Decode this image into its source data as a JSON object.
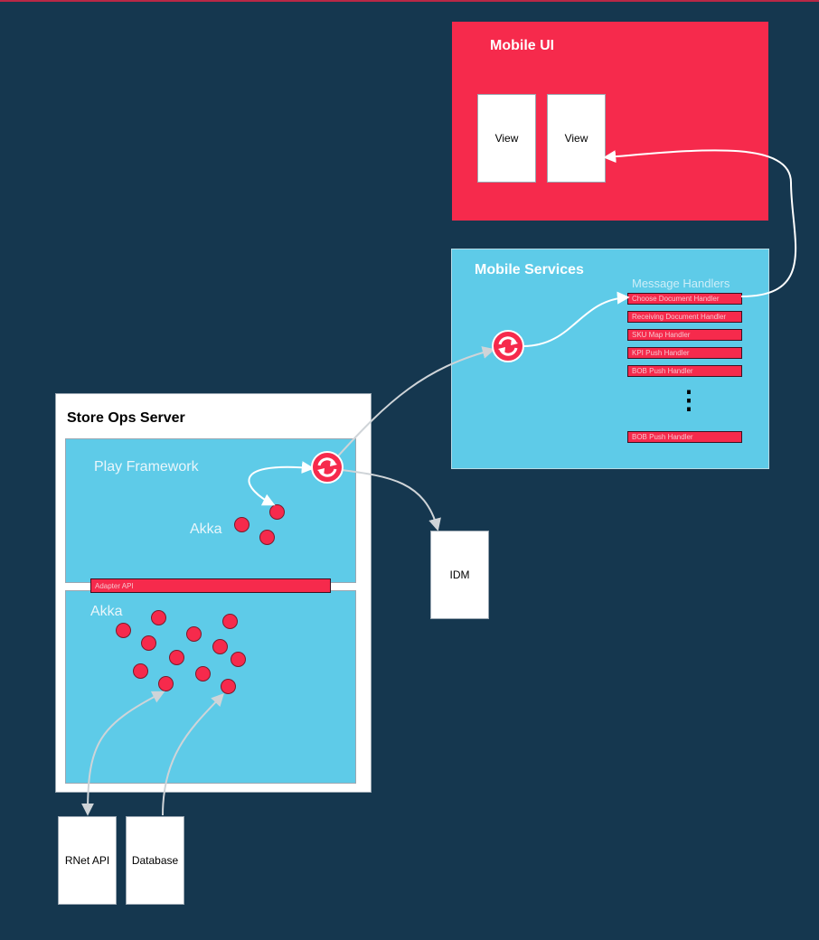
{
  "mobile_ui": {
    "title": "Mobile UI",
    "views": [
      "View",
      "View"
    ]
  },
  "mobile_services": {
    "title": "Mobile Services",
    "handlers_heading": "Message Handlers",
    "handlers": [
      "Choose Document Handler",
      "Receiving Document Handler",
      "SKU Map Handler",
      "KPI Push Handler",
      "BOB Push Handler"
    ],
    "ellipsis": "⋮",
    "last_handler": "BOB Push Handler"
  },
  "store_ops": {
    "title": "Store Ops Server",
    "play_label": "Play Framework",
    "play_akka_label": "Akka",
    "adapter_label": "Adapter API",
    "akka_label": "Akka"
  },
  "externals": {
    "idm": "IDM",
    "rnet": "RNet API",
    "database": "Database"
  },
  "colors": {
    "background": "#15374f",
    "red": "#f62a4c",
    "cyan": "#5ecbe8",
    "white": "#ffffff"
  },
  "icons": [
    "sync-icon",
    "sync-icon"
  ]
}
